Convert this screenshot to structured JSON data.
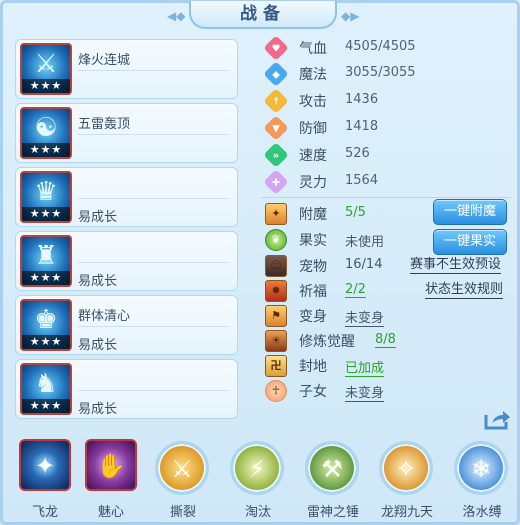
{
  "title": "战备",
  "equipment": [
    {
      "name": "烽火连城",
      "stars": "★★★",
      "name_pos": "top"
    },
    {
      "name": "五雷轰顶",
      "stars": "★★★",
      "name_pos": "top"
    },
    {
      "name": "易成长",
      "stars": "★★★",
      "name_pos": "bottom"
    },
    {
      "name": "易成长",
      "stars": "★★★",
      "name_pos": "bottom"
    },
    {
      "name": "群体清心",
      "name2": "易成长",
      "stars": "★★★",
      "name_pos": "both"
    },
    {
      "name": "易成长",
      "stars": "★★★",
      "name_pos": "bottom"
    }
  ],
  "attributes": [
    {
      "label": "气血",
      "value": "4505/4505",
      "color": "#f06a8a"
    },
    {
      "label": "魔法",
      "value": "3055/3055",
      "color": "#4aa8f0"
    },
    {
      "label": "攻击",
      "value": "1436",
      "color": "#f5b93a"
    },
    {
      "label": "防御",
      "value": "1418",
      "color": "#f5995a"
    },
    {
      "label": "速度",
      "value": "526",
      "color": "#2fc77a"
    },
    {
      "label": "灵力",
      "value": "1564",
      "color": "#d5a6f0"
    }
  ],
  "status": {
    "fumo": {
      "label": "附魔",
      "value": "5/5"
    },
    "guoshi": {
      "label": "果实",
      "value": "未使用"
    },
    "chongwu": {
      "label": "宠物",
      "value": "16/14"
    },
    "qifu": {
      "label": "祈福",
      "value": "2/2"
    },
    "bianshen": {
      "label": "变身",
      "value": "未变身"
    },
    "xiulian": {
      "label": "修炼觉醒",
      "value": "8/8"
    },
    "fengdi": {
      "label": "封地",
      "value": "已加成"
    },
    "zinv": {
      "label": "子女",
      "value": "未变身"
    }
  },
  "buttons": {
    "one_key_enchant": "一键附魔",
    "one_key_fruit": "一键果实"
  },
  "links": {
    "event_preset": "赛事不生效预设",
    "status_rules": "状态生效规则"
  },
  "skills": [
    {
      "name": "飞龙",
      "style": "box",
      "glyph": "✦",
      "bg": "#1a3f7a"
    },
    {
      "name": "魅心",
      "style": "box",
      "glyph": "✋",
      "bg": "#8a3aa0"
    },
    {
      "name": "撕裂",
      "style": "circle",
      "glyph": "⚔",
      "bg": "#e0a030"
    },
    {
      "name": "淘汰",
      "style": "circle",
      "glyph": "⚡",
      "bg": "#9ab84a"
    },
    {
      "name": "雷神之锤",
      "style": "circle",
      "glyph": "⚒",
      "bg": "#6aa04a"
    },
    {
      "name": "龙翔九天",
      "style": "circle",
      "glyph": "✧",
      "bg": "#e0a040"
    },
    {
      "name": "洛水缚",
      "style": "circle",
      "glyph": "❄",
      "bg": "#5a9ae0"
    }
  ]
}
